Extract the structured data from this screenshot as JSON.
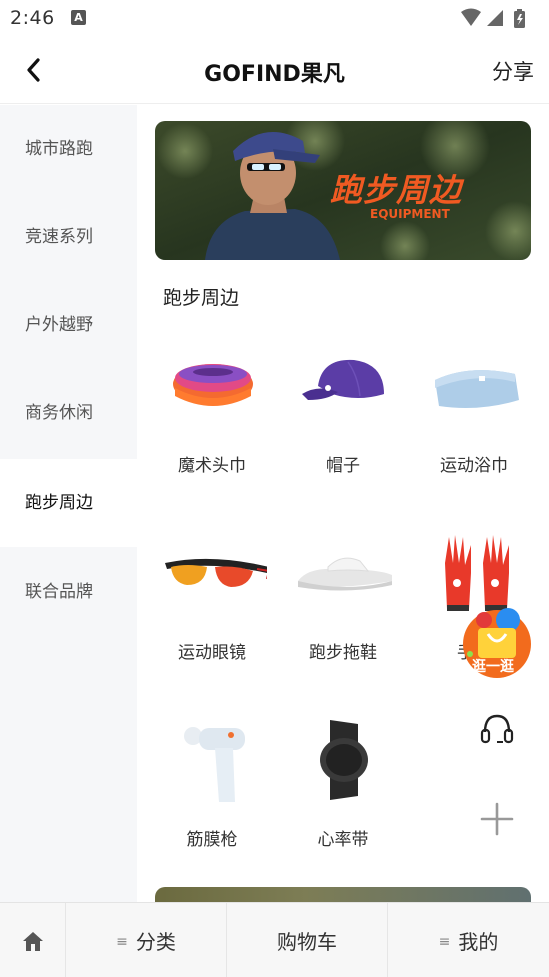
{
  "status_bar": {
    "time": "2:46",
    "notification_glyph": "A"
  },
  "header": {
    "title": "GOFIND果凡",
    "share_label": "分享"
  },
  "sidebar": {
    "items": [
      {
        "label": "城市路跑"
      },
      {
        "label": "竞速系列"
      },
      {
        "label": "户外越野"
      },
      {
        "label": "商务休闲"
      },
      {
        "label": "跑步周边",
        "active": true
      },
      {
        "label": "联合品牌"
      }
    ]
  },
  "banner": {
    "title": "跑步周边",
    "subtitle": "EQUIPMENT"
  },
  "section": {
    "title": "跑步周边"
  },
  "products": [
    {
      "label": "魔术头巾",
      "icon": "magic-headband"
    },
    {
      "label": "帽子",
      "icon": "cap"
    },
    {
      "label": "运动浴巾",
      "icon": "bath-towel"
    },
    {
      "label": "运动眼镜",
      "icon": "sport-glasses"
    },
    {
      "label": "跑步拖鞋",
      "icon": "slippers"
    },
    {
      "label": "手套",
      "icon": "gloves"
    },
    {
      "label": "筋膜枪",
      "icon": "massage-gun"
    },
    {
      "label": "心率带",
      "icon": "heart-rate-strap"
    }
  ],
  "floating": {
    "shop_label": "逛一逛"
  },
  "tabbar": {
    "category": "分类",
    "cart": "购物车",
    "me": "我的"
  },
  "colors": {
    "accent": "#f05a22",
    "sidebar_bg": "#f6f7f9",
    "tabbar_bg": "#f7f7f7"
  }
}
